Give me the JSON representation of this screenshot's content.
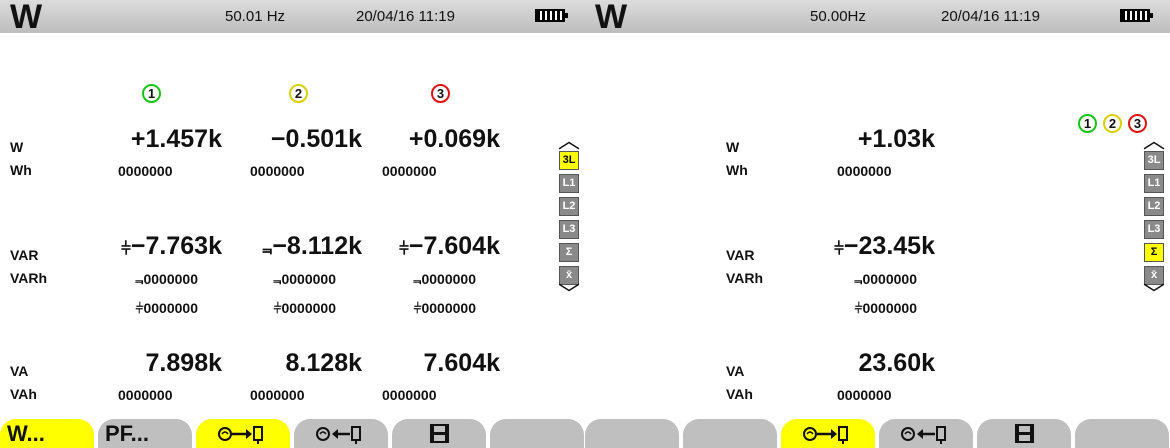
{
  "screens": [
    {
      "status": {
        "frequency": "50.01 Hz",
        "datetime": "20/04/16  11:19"
      },
      "phases": [
        "1",
        "2",
        "3"
      ],
      "view_modes": [
        "3L",
        "L1",
        "L2",
        "L3",
        "Σ",
        "x̄"
      ],
      "active_mode": "3L",
      "labels": {
        "w": "W",
        "wh": "Wh",
        "var": "VAR",
        "varh": "VARh",
        "va": "VA",
        "vah": "VAh"
      },
      "columns": [
        {
          "w": "+1.457k",
          "wh": "0000000",
          "var": "−7.763k",
          "var_sign": "⫩",
          "varh": "0000000",
          "varh2": "0000000",
          "va": "7.898k",
          "vah": "0000000"
        },
        {
          "w": "−0.501k",
          "wh": "0000000",
          "var": "−8.112k",
          "var_sign": "⫬",
          "varh": "0000000",
          "varh2": "0000000",
          "va": "8.128k",
          "vah": "0000000"
        },
        {
          "w": "+0.069k",
          "wh": "0000000",
          "var": "−7.604k",
          "var_sign": "⫩",
          "varh": "0000000",
          "varh2": "0000000",
          "va": "7.604k",
          "vah": "0000000"
        }
      ],
      "softkeys": [
        {
          "label": "W...",
          "icon": "",
          "active": true
        },
        {
          "label": "PF...",
          "icon": "",
          "active": false
        },
        {
          "label": "",
          "icon": "meter-to-computer-icon",
          "active": true
        },
        {
          "label": "",
          "icon": "meter-from-computer-icon",
          "active": false
        },
        {
          "label": "",
          "icon": "save-icon",
          "active": false
        },
        {
          "label": "",
          "icon": "",
          "active": false
        }
      ]
    },
    {
      "status": {
        "frequency": "50.00Hz",
        "datetime": "20/04/16  11:19"
      },
      "phases": [
        "1",
        "2",
        "3"
      ],
      "view_modes": [
        "3L",
        "L1",
        "L2",
        "L3",
        "Σ",
        "x̄"
      ],
      "active_mode": "Σ",
      "labels": {
        "w": "W",
        "wh": "Wh",
        "var": "VAR",
        "varh": "VARh",
        "va": "VA",
        "vah": "VAh"
      },
      "total": {
        "w": "+1.03k",
        "wh": "0000000",
        "var": "−23.45k",
        "var_sign": "⫩",
        "varh": "0000000",
        "varh2": "0000000",
        "va": "23.60k",
        "vah": "0000000"
      },
      "softkeys": [
        {
          "label": "",
          "icon": "",
          "active": false
        },
        {
          "label": "",
          "icon": "",
          "active": false
        },
        {
          "label": "",
          "icon": "meter-to-computer-icon",
          "active": true
        },
        {
          "label": "",
          "icon": "meter-from-computer-icon",
          "active": false
        },
        {
          "label": "",
          "icon": "save-icon",
          "active": false
        },
        {
          "label": "",
          "icon": "",
          "active": false
        }
      ]
    }
  ],
  "colors": {
    "phase1": "#16c416",
    "phase2": "#d8d000",
    "phase3": "#e01010",
    "active": "#ffff00",
    "inactive": "#8a8a8a"
  }
}
